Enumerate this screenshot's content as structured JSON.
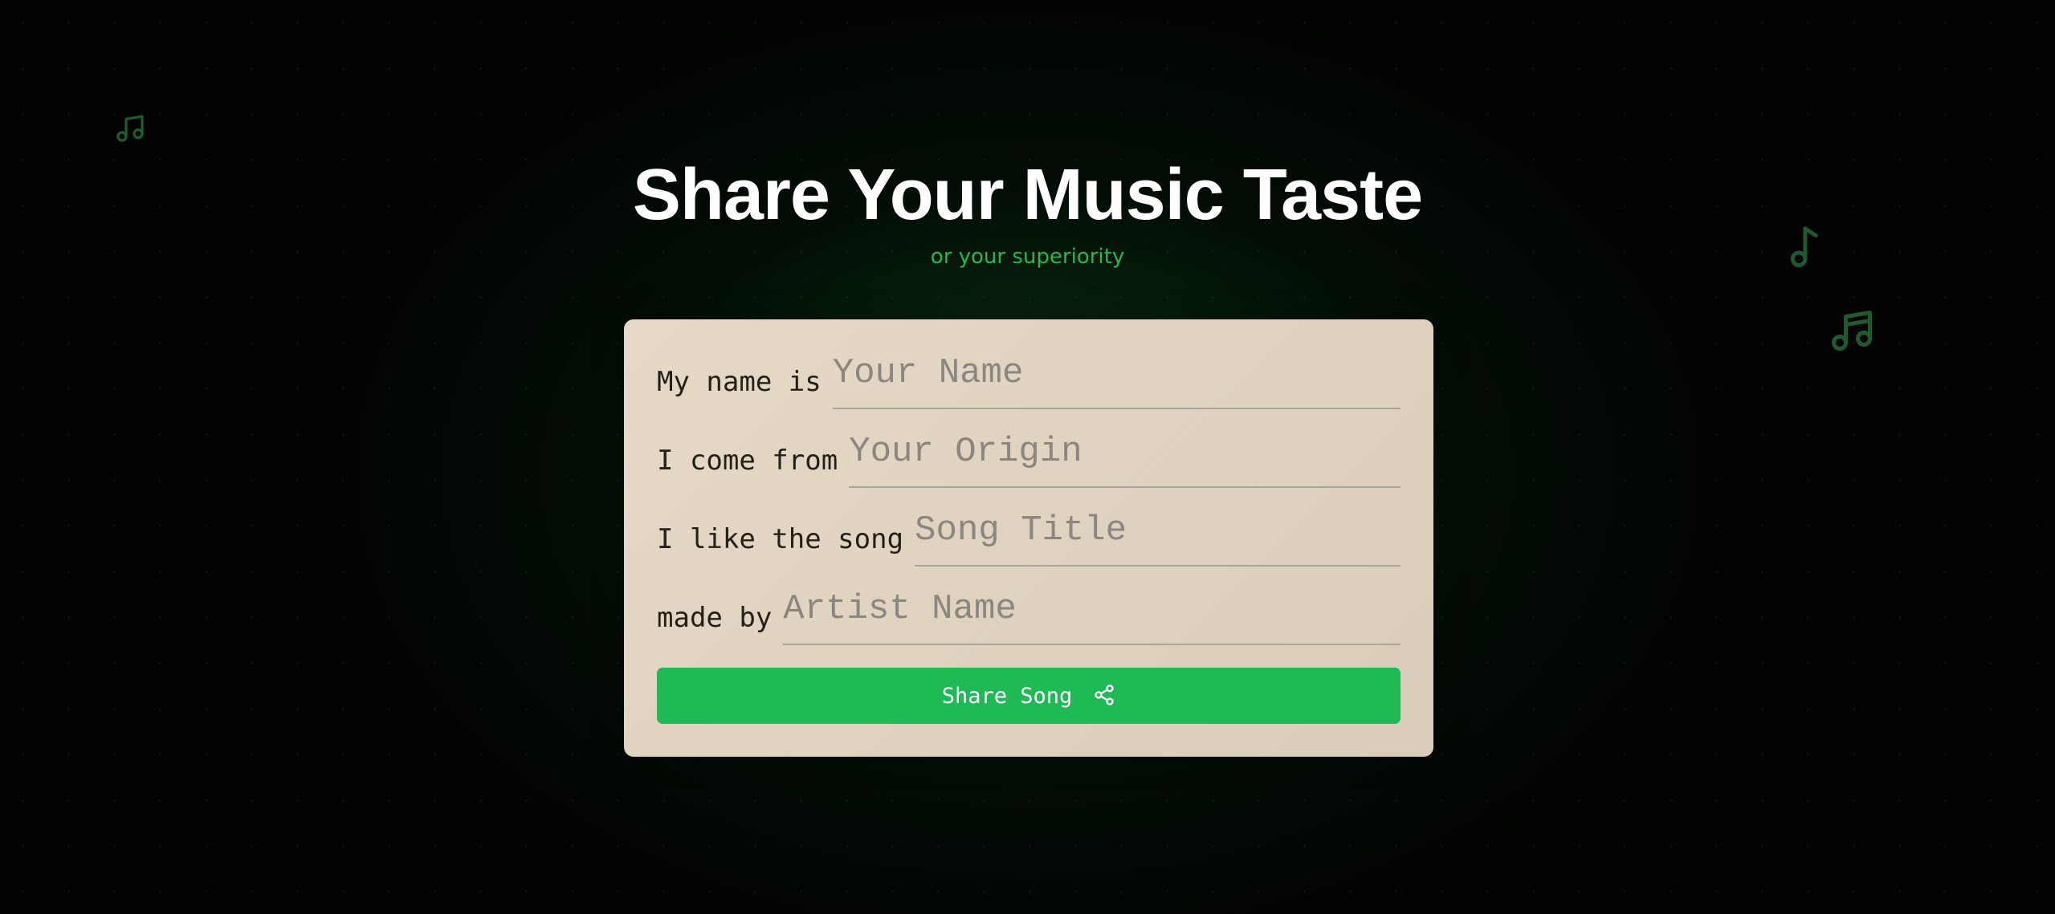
{
  "header": {
    "title": "Share Your Music Taste",
    "subtitle": "or your superiority"
  },
  "form": {
    "fields": [
      {
        "label": "My name is",
        "placeholder": "Your Name",
        "value": ""
      },
      {
        "label": "I come from",
        "placeholder": "Your Origin",
        "value": ""
      },
      {
        "label": "I like the song",
        "placeholder": "Song Title",
        "value": ""
      },
      {
        "label": "made by",
        "placeholder": "Artist Name",
        "value": ""
      }
    ],
    "submit_label": "Share Song",
    "submit_icon": "share-icon"
  },
  "decorations": {
    "icons": [
      "music-notes-icon",
      "music-note-icon",
      "music-notes-icon"
    ]
  },
  "colors": {
    "accent": "#1fba55",
    "subtitle": "#22b84f",
    "card": "#e0d5c2",
    "background": "#020302"
  }
}
